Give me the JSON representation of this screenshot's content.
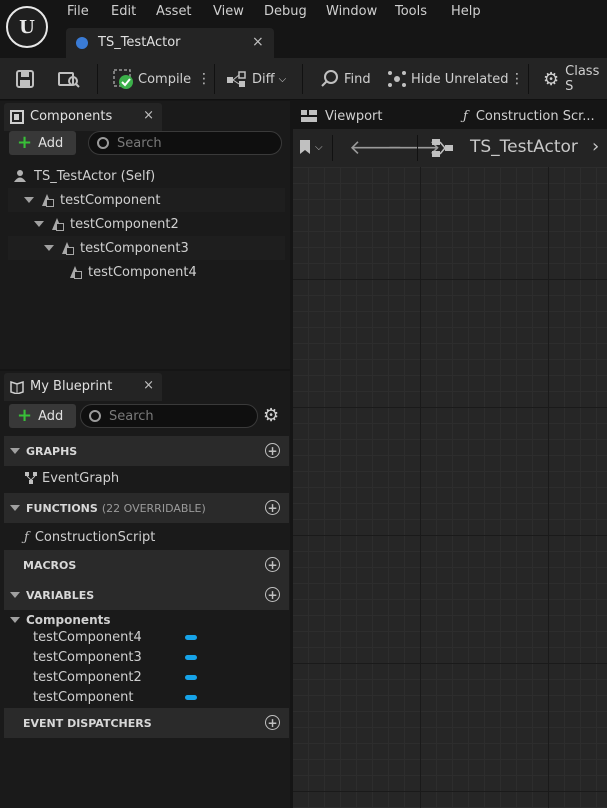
{
  "menu": [
    "File",
    "Edit",
    "Asset",
    "View",
    "Debug",
    "Window",
    "Tools",
    "Help"
  ],
  "document_tab": {
    "label": "TS_TestActor",
    "close": "×"
  },
  "toolbar": {
    "compile": "Compile",
    "diff": "Diff",
    "find": "Find",
    "hide_unrelated": "Hide Unrelated",
    "class_settings": "Class S"
  },
  "components_panel": {
    "title": "Components",
    "close": "×",
    "add": "Add",
    "search_placeholder": "Search",
    "tree": [
      {
        "label": "TS_TestActor (Self)"
      },
      {
        "label": "testComponent"
      },
      {
        "label": "testComponent2"
      },
      {
        "label": "testComponent3"
      },
      {
        "label": "testComponent4"
      }
    ]
  },
  "blueprint_panel": {
    "title": "My Blueprint",
    "close": "×",
    "add": "Add",
    "search_placeholder": "Search",
    "graphs": {
      "title": "GRAPHS",
      "items": [
        "EventGraph"
      ]
    },
    "functions": {
      "title": "FUNCTIONS",
      "count": "(22 OVERRIDABLE)",
      "items": [
        "ConstructionScript"
      ]
    },
    "macros": {
      "title": "MACROS"
    },
    "variables": {
      "title": "VARIABLES",
      "category": "Components",
      "items": [
        "testComponent4",
        "testComponent3",
        "testComponent2",
        "testComponent"
      ],
      "pill_color": "#16a3e8"
    },
    "event_dispatchers": {
      "title": "EVENT DISPATCHERS"
    }
  },
  "editor_tabs": {
    "viewport": "Viewport",
    "construction": "Construction Scr..."
  },
  "graph_nav": {
    "breadcrumb": "TS_TestActor"
  }
}
